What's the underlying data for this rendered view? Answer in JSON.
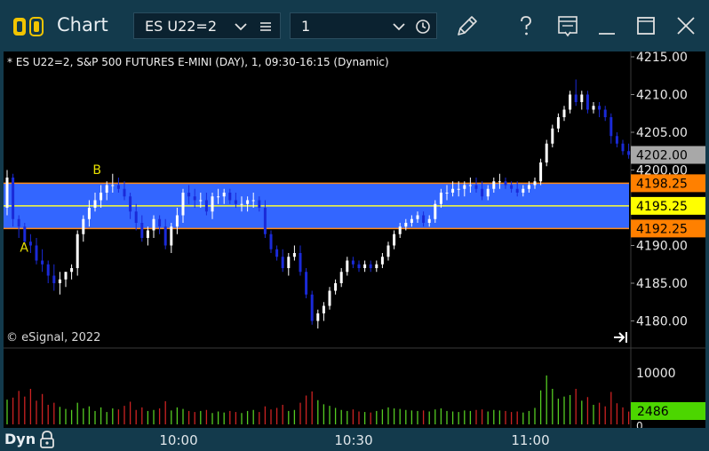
{
  "window": {
    "title": "Chart",
    "symbol": "ES U22=2",
    "interval": "1"
  },
  "chart": {
    "description": "* ES U22=2, S&P 500 FUTURES E-MINI (DAY), 1, 09:30-16:15 (Dynamic)",
    "copyright": "© eSignal, 2022",
    "annotations": [
      "A",
      "B"
    ],
    "price_ticks": [
      "4215.00",
      "4210.00",
      "4205.00",
      "4200.00",
      "4190.00",
      "4185.00",
      "4180.00"
    ],
    "current_price": "4202.00",
    "band_upper": "4198.25",
    "band_mid": "4195.25",
    "band_lower": "4192.25",
    "volume_ticks": [
      "10000",
      "0"
    ],
    "volume_current": "2486",
    "colors": {
      "up_candle": "#ffffff",
      "down_candle": "#1a2ad8",
      "band_fill": "#3366ff",
      "band_edge": "#ff8c1a",
      "band_mid": "#ffff33",
      "current_price_bg": "#a8a8a8",
      "band_label_bg": "#ff8000",
      "mid_label_bg": "#ffff00",
      "volume_label_bg": "#4cd600",
      "volume_up": "#55cc22",
      "volume_down": "#cc2222"
    }
  },
  "footer": {
    "mode": "Dyn",
    "time_labels": [
      "10:00",
      "10:30",
      "11:00"
    ]
  },
  "chart_data": {
    "type": "candlestick",
    "x": [
      "09:30",
      "09:31",
      "09:32",
      "09:33",
      "09:34",
      "09:35",
      "09:36",
      "09:37",
      "09:38",
      "09:39",
      "09:40",
      "09:41",
      "09:42",
      "09:43",
      "09:44",
      "09:45",
      "09:46",
      "09:47",
      "09:48",
      "09:49",
      "09:50",
      "09:51",
      "09:52",
      "09:53",
      "09:54",
      "09:55",
      "09:56",
      "09:57",
      "09:58",
      "09:59",
      "10:00",
      "10:01",
      "10:02",
      "10:03",
      "10:04",
      "10:05",
      "10:06",
      "10:07",
      "10:08",
      "10:09",
      "10:10",
      "10:11",
      "10:12",
      "10:13",
      "10:14",
      "10:15",
      "10:16",
      "10:17",
      "10:18",
      "10:19",
      "10:20",
      "10:21",
      "10:22",
      "10:23",
      "10:24",
      "10:25",
      "10:26",
      "10:27",
      "10:28",
      "10:29",
      "10:30",
      "10:31",
      "10:32",
      "10:33",
      "10:34",
      "10:35",
      "10:36",
      "10:37",
      "10:38",
      "10:39",
      "10:40",
      "10:41",
      "10:42",
      "10:43",
      "10:44",
      "10:45",
      "10:46",
      "10:47",
      "10:48",
      "10:49",
      "10:50",
      "10:51",
      "10:52",
      "10:53",
      "10:54",
      "10:55",
      "10:56",
      "10:57",
      "10:58",
      "10:59",
      "11:00",
      "11:01",
      "11:02",
      "11:03",
      "11:04",
      "11:05",
      "11:06",
      "11:07",
      "11:08",
      "11:09",
      "11:10",
      "11:11",
      "11:12",
      "11:13",
      "11:14",
      "11:15",
      "11:16"
    ],
    "open": [
      4195.0,
      4199.0,
      4193.5,
      4192.5,
      4190.5,
      4190.0,
      4188.0,
      4187.5,
      4186.0,
      4185.0,
      4185.5,
      4186.5,
      4187.0,
      4191.5,
      4193.5,
      4195.0,
      4196.0,
      4197.0,
      4198.0,
      4198.0,
      4197.5,
      4196.5,
      4194.5,
      4193.0,
      4191.0,
      4192.0,
      4193.5,
      4192.5,
      4190.0,
      4192.5,
      4194.0,
      4197.0,
      4196.5,
      4196.0,
      4196.0,
      4194.5,
      4196.5,
      4196.5,
      4197.0,
      4196.0,
      4195.5,
      4195.5,
      4196.0,
      4196.0,
      4195.0,
      4191.5,
      4189.5,
      4188.5,
      4187.0,
      4188.5,
      4189.0,
      4186.5,
      4183.5,
      4180.0,
      4181.0,
      4182.0,
      4184.0,
      4185.0,
      4186.5,
      4188.0,
      4187.5,
      4187.0,
      4187.5,
      4187.0,
      4187.5,
      4188.5,
      4190.0,
      4191.5,
      4192.5,
      4193.0,
      4193.5,
      4194.0,
      4193.0,
      4193.5,
      4195.5,
      4197.0,
      4197.0,
      4197.5,
      4197.5,
      4198.0,
      4198.0,
      4197.5,
      4196.5,
      4197.5,
      4198.5,
      4198.5,
      4198.0,
      4197.5,
      4197.0,
      4197.5,
      4198.0,
      4198.5,
      4201.0,
      4203.5,
      4205.5,
      4207.0,
      4208.0,
      4210.0,
      4209.0,
      4210.0,
      4208.0,
      4208.5,
      4208.0,
      4207.0,
      4204.5,
      4203.5,
      4202.5
    ],
    "high": [
      4200.0,
      4199.5,
      4194.0,
      4193.0,
      4191.5,
      4191.0,
      4189.5,
      4188.0,
      4187.5,
      4186.5,
      4186.5,
      4187.5,
      4192.0,
      4194.0,
      4196.0,
      4197.0,
      4198.0,
      4198.5,
      4199.5,
      4199.0,
      4198.5,
      4197.0,
      4195.5,
      4194.0,
      4192.5,
      4194.0,
      4194.0,
      4193.5,
      4193.0,
      4195.0,
      4197.5,
      4198.0,
      4197.5,
      4197.0,
      4197.0,
      4197.0,
      4197.5,
      4197.5,
      4197.5,
      4197.0,
      4196.5,
      4196.5,
      4197.0,
      4196.5,
      4196.0,
      4192.0,
      4190.0,
      4189.5,
      4189.0,
      4190.0,
      4190.0,
      4187.0,
      4184.0,
      4181.5,
      4182.5,
      4184.5,
      4185.5,
      4187.0,
      4188.5,
      4188.5,
      4188.0,
      4188.0,
      4188.0,
      4188.0,
      4189.0,
      4190.5,
      4192.0,
      4193.0,
      4193.5,
      4194.0,
      4194.5,
      4194.5,
      4194.0,
      4196.0,
      4197.5,
      4198.0,
      4198.5,
      4198.5,
      4198.5,
      4199.0,
      4199.0,
      4198.5,
      4198.0,
      4199.0,
      4199.5,
      4199.0,
      4198.5,
      4198.5,
      4198.0,
      4198.5,
      4199.0,
      4201.5,
      4204.0,
      4206.0,
      4207.5,
      4208.5,
      4210.5,
      4212.0,
      4210.5,
      4210.5,
      4209.0,
      4209.0,
      4208.5,
      4207.5,
      4205.0,
      4204.0,
      4203.5
    ],
    "low": [
      4194.0,
      4192.5,
      4191.0,
      4190.0,
      4189.0,
      4187.5,
      4186.5,
      4185.0,
      4184.0,
      4183.5,
      4184.5,
      4185.5,
      4186.0,
      4190.5,
      4192.5,
      4194.5,
      4195.0,
      4196.0,
      4197.0,
      4197.0,
      4196.0,
      4193.5,
      4192.0,
      4190.5,
      4190.0,
      4191.0,
      4191.5,
      4189.5,
      4189.0,
      4191.5,
      4193.0,
      4195.5,
      4195.0,
      4195.0,
      4194.0,
      4193.5,
      4195.5,
      4195.5,
      4195.5,
      4195.0,
      4194.5,
      4194.5,
      4195.0,
      4194.5,
      4191.0,
      4189.0,
      4188.0,
      4186.5,
      4186.0,
      4188.0,
      4186.0,
      4183.0,
      4179.5,
      4179.0,
      4180.0,
      4181.5,
      4183.5,
      4184.5,
      4186.0,
      4187.0,
      4186.5,
      4186.5,
      4186.5,
      4186.5,
      4187.0,
      4188.0,
      4189.5,
      4191.0,
      4192.0,
      4192.5,
      4193.0,
      4192.5,
      4192.5,
      4193.0,
      4195.0,
      4196.0,
      4196.5,
      4196.5,
      4196.5,
      4197.0,
      4197.0,
      4196.0,
      4196.0,
      4197.0,
      4197.5,
      4197.5,
      4197.0,
      4196.5,
      4196.5,
      4197.0,
      4197.5,
      4198.0,
      4200.5,
      4203.0,
      4205.0,
      4206.5,
      4207.5,
      4208.5,
      4208.0,
      4207.5,
      4207.5,
      4207.0,
      4206.5,
      4203.5,
      4203.0,
      4202.0,
      4201.5
    ],
    "close": [
      4199.0,
      4193.5,
      4192.5,
      4190.5,
      4190.0,
      4188.0,
      4187.5,
      4186.0,
      4185.0,
      4185.5,
      4186.5,
      4187.0,
      4191.5,
      4193.5,
      4195.0,
      4196.0,
      4197.0,
      4198.0,
      4198.0,
      4197.5,
      4196.5,
      4194.5,
      4193.0,
      4191.0,
      4192.0,
      4193.5,
      4192.5,
      4190.0,
      4192.5,
      4194.0,
      4197.0,
      4196.5,
      4196.0,
      4196.0,
      4194.5,
      4196.5,
      4196.5,
      4197.0,
      4196.0,
      4195.5,
      4195.5,
      4196.0,
      4196.0,
      4195.0,
      4191.5,
      4189.5,
      4188.5,
      4187.0,
      4188.5,
      4189.0,
      4186.5,
      4183.5,
      4180.0,
      4181.0,
      4182.0,
      4184.0,
      4185.0,
      4186.5,
      4188.0,
      4187.5,
      4187.0,
      4187.5,
      4187.0,
      4187.5,
      4188.5,
      4190.0,
      4191.5,
      4192.5,
      4193.0,
      4193.5,
      4194.0,
      4193.0,
      4193.5,
      4195.5,
      4197.0,
      4197.0,
      4197.5,
      4197.5,
      4198.0,
      4198.0,
      4197.5,
      4196.5,
      4197.5,
      4198.5,
      4198.5,
      4198.0,
      4197.5,
      4197.0,
      4197.5,
      4198.0,
      4198.5,
      4201.0,
      4203.5,
      4205.5,
      4207.0,
      4208.0,
      4210.0,
      4209.0,
      4210.0,
      4208.0,
      4208.5,
      4208.0,
      4207.0,
      4204.5,
      4203.5,
      4202.5,
      4202.0
    ],
    "volume": [
      4800,
      5200,
      6500,
      5400,
      6900,
      4600,
      5900,
      3800,
      4200,
      3400,
      3000,
      2800,
      4200,
      3100,
      3500,
      2600,
      3300,
      2400,
      3100,
      2900,
      3600,
      4400,
      2800,
      3300,
      2600,
      2800,
      3100,
      4500,
      2700,
      3300,
      3000,
      2600,
      2400,
      2600,
      2800,
      2200,
      2500,
      2300,
      2600,
      2400,
      2200,
      2600,
      2800,
      2400,
      3500,
      2900,
      3200,
      3800,
      2600,
      2800,
      4200,
      5600,
      6400,
      4700,
      3900,
      3600,
      3200,
      2800,
      2600,
      2900,
      2500,
      2400,
      2300,
      2600,
      2900,
      3300,
      3100,
      3000,
      2800,
      2700,
      2600,
      2700,
      2500,
      2900,
      3100,
      2600,
      2500,
      2400,
      2700,
      2600,
      2800,
      2900,
      2500,
      2800,
      2700,
      2600,
      2400,
      2500,
      2300,
      2600,
      3200,
      6600,
      9500,
      6900,
      5000,
      5400,
      5700,
      6900,
      4600,
      5300,
      3800,
      4200,
      3500,
      6300,
      4100,
      3300,
      2486
    ],
    "ylim": [
      4178,
      4217
    ],
    "volume_ylim": [
      0,
      12500
    ],
    "band": {
      "upper": 4198.25,
      "mid": 4195.25,
      "lower": 4192.25
    },
    "grid": true
  }
}
